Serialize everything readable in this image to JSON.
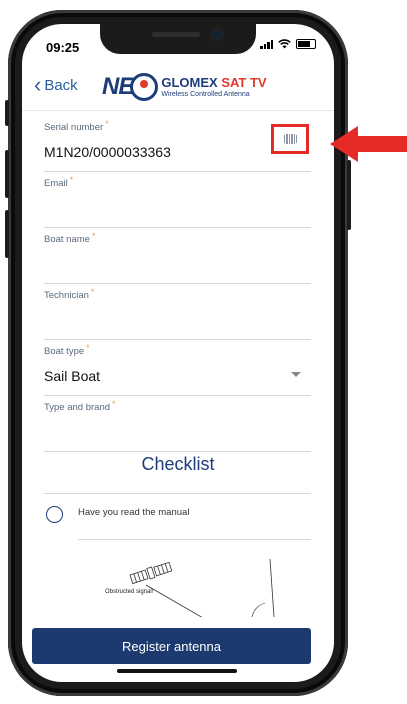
{
  "status_bar": {
    "time": "09:25"
  },
  "header": {
    "back_label": "Back",
    "logo": {
      "neo": "NEO",
      "brand_main": "GLOMEX",
      "brand_accent": "SAT TV",
      "subtitle": "Wireless Controlled Antenna"
    }
  },
  "form": {
    "serial": {
      "label": "Serial number",
      "value": "M1N20/0000033363"
    },
    "email": {
      "label": "Email",
      "value": ""
    },
    "boat_name": {
      "label": "Boat name",
      "value": ""
    },
    "technician": {
      "label": "Technician",
      "value": ""
    },
    "boat_type": {
      "label": "Boat type",
      "value": "Sail Boat"
    },
    "type_brand": {
      "label": "Type and brand",
      "value": ""
    },
    "required_mark": "*"
  },
  "checklist": {
    "title": "Checklist",
    "items": [
      {
        "label": "Have you read the manual"
      }
    ],
    "diagram_label": "Obstructed signal!"
  },
  "register_label": "Register antenna",
  "colors": {
    "primary": "#1d3a70",
    "accent_red": "#e52b28",
    "required": "#e8a34a"
  },
  "icons": {
    "barcode": "barcode-scan-icon",
    "back": "chevron-left-icon",
    "dropdown": "chevron-down-icon",
    "annotation": "red-arrow-icon"
  }
}
